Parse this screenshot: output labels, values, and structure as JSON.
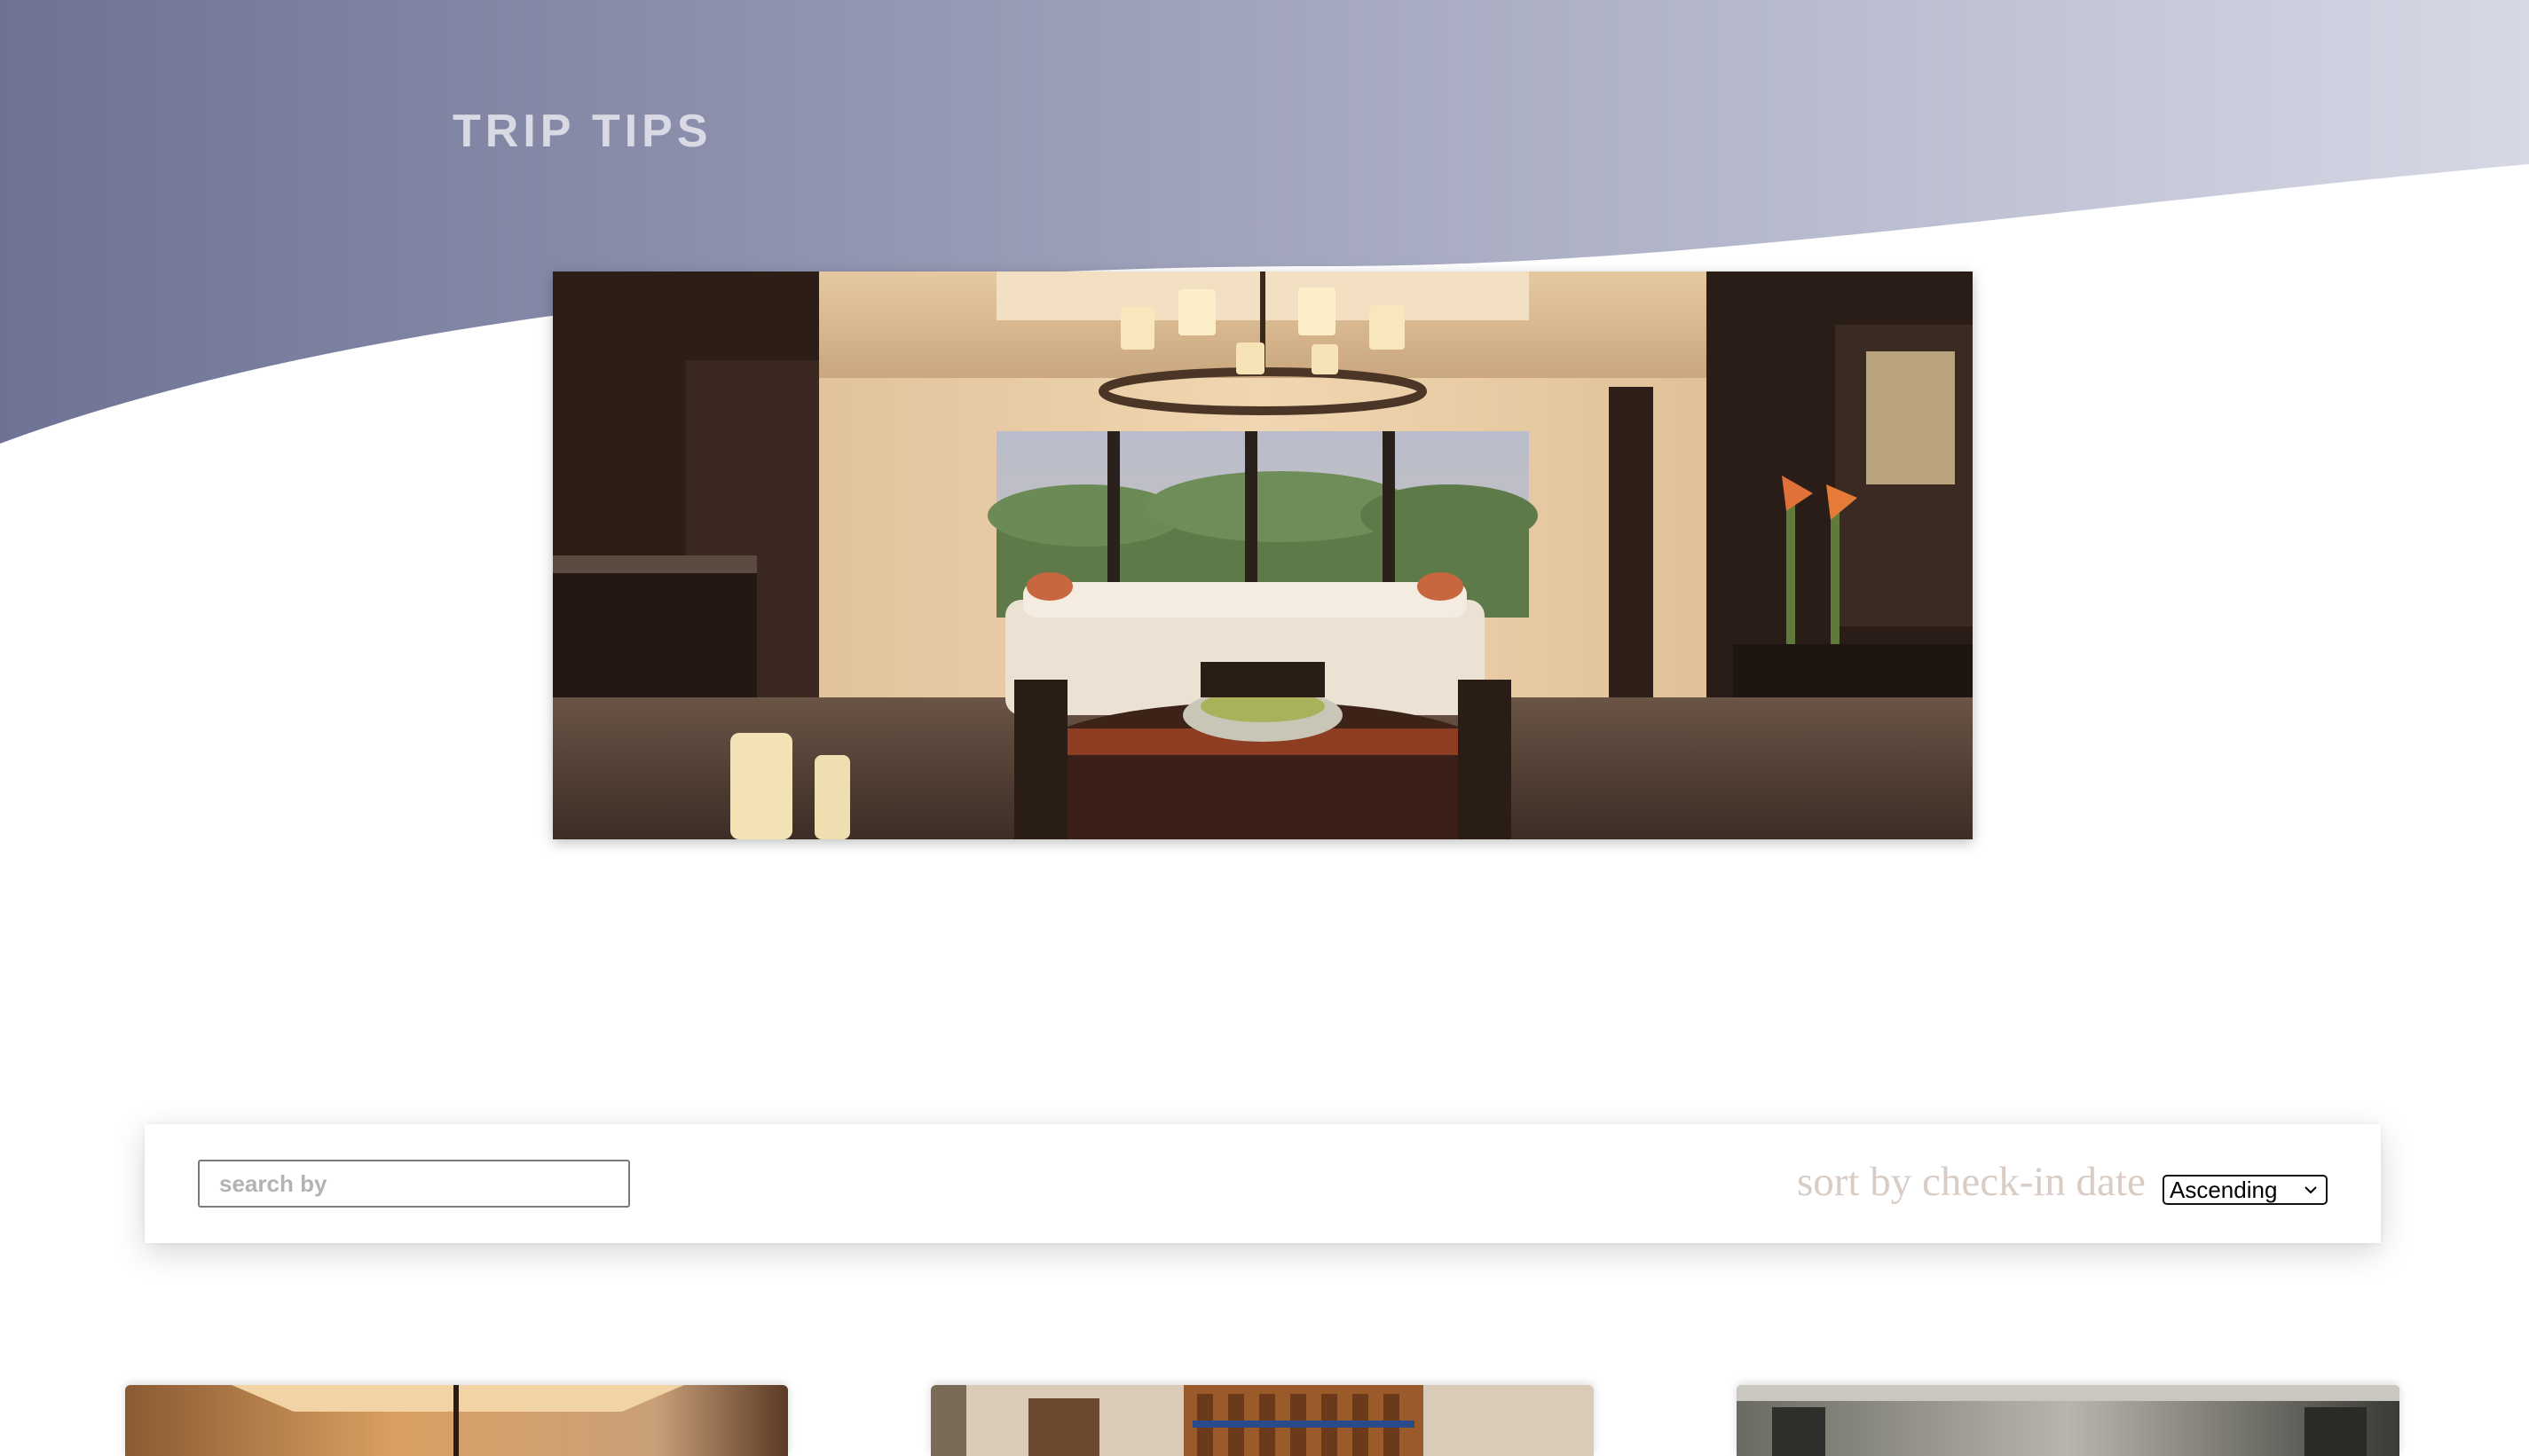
{
  "header": {
    "brand": "TRIP TIPS",
    "gradient_start": "#6e7395",
    "gradient_end": "#d6d8e5"
  },
  "hero": {
    "image": "hotel-suite-dining-room-photo"
  },
  "toolbar": {
    "search_placeholder": "search by",
    "search_value": "",
    "sort_label": "sort by check-in date",
    "sort_selected": "Ascending"
  },
  "cards": [
    {
      "image": "hotel-room-photo-1"
    },
    {
      "image": "hotel-room-photo-2"
    },
    {
      "image": "hotel-room-photo-3"
    }
  ]
}
